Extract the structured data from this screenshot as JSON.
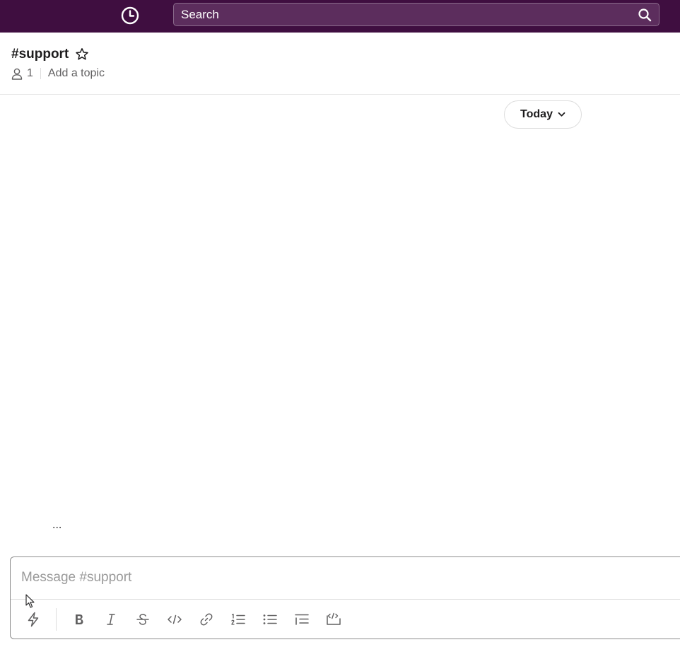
{
  "topbar": {
    "history_icon": "clock-icon",
    "search": {
      "label": "Search",
      "icon": "search-icon"
    },
    "background": "#3f0e40"
  },
  "channel": {
    "name": "#support",
    "star_icon": "star-outline-icon",
    "member_icon": "person-icon",
    "member_count": "1",
    "topic_placeholder": "Add a topic"
  },
  "messages": {
    "date_divider": "Today",
    "typing_indicator": "..."
  },
  "composer": {
    "placeholder": "Message #support",
    "toolbar": [
      {
        "name": "shortcuts",
        "icon": "lightning-icon"
      },
      {
        "name": "bold",
        "icon": "bold-icon"
      },
      {
        "name": "italic",
        "icon": "italic-icon"
      },
      {
        "name": "strikethrough",
        "icon": "strikethrough-icon"
      },
      {
        "name": "code",
        "icon": "code-icon"
      },
      {
        "name": "link",
        "icon": "link-icon"
      },
      {
        "name": "ordered-list",
        "icon": "ordered-list-icon"
      },
      {
        "name": "bulleted-list",
        "icon": "bulleted-list-icon"
      },
      {
        "name": "blockquote",
        "icon": "blockquote-icon"
      },
      {
        "name": "code-block",
        "icon": "code-block-icon"
      }
    ]
  }
}
